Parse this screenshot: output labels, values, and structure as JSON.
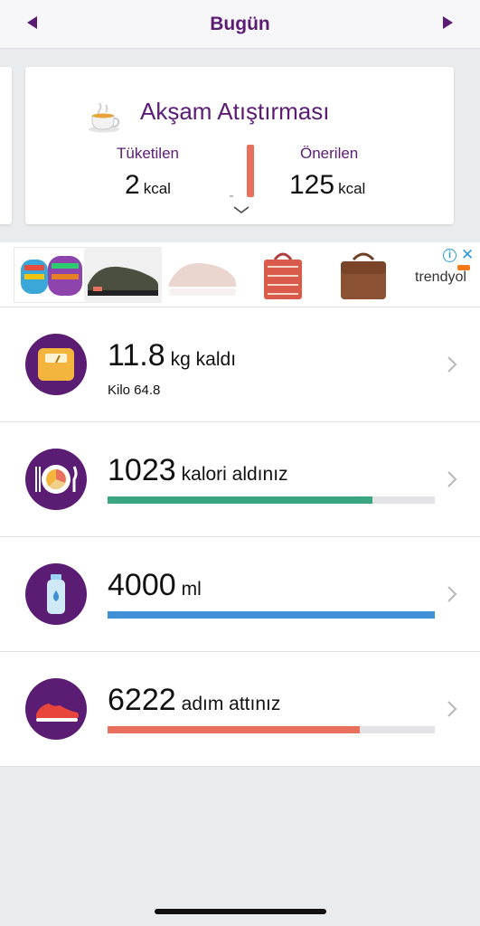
{
  "header": {
    "title": "Bugün",
    "prev_icon": "triangle-left-icon",
    "next_icon": "triangle-right-icon"
  },
  "meal": {
    "icon": "tea-cup-icon",
    "title": "Akşam Atıştırması",
    "consumed_label": "Tüketilen",
    "consumed_value": "2",
    "consumed_unit": "kcal",
    "recommended_label": "Önerilen",
    "recommended_value": "125",
    "recommended_unit": "kcal",
    "meter_color": "#e8705c"
  },
  "ad": {
    "brand": "trendyol",
    "info_icon": "info-icon",
    "close_icon": "close-icon"
  },
  "rows": [
    {
      "value": "11.8",
      "suffix": "kg kaldı",
      "subtitle": "Kilo 64.8",
      "icon": "scale-icon"
    },
    {
      "value": "1023",
      "suffix": "kalori aldınız",
      "progress": 0.81,
      "bar_color": "#3aa782",
      "icon": "plate-icon"
    },
    {
      "value": "4000",
      "suffix": "ml",
      "progress": 1.0,
      "bar_color": "#3f8fd6",
      "icon": "water-bottle-icon"
    },
    {
      "value": "6222",
      "suffix": "adım attınız",
      "progress": 0.77,
      "bar_color": "#e8705c",
      "icon": "sneaker-icon"
    }
  ],
  "colors": {
    "brand_purple": "#5b1d73",
    "background": "#e9ecee"
  }
}
